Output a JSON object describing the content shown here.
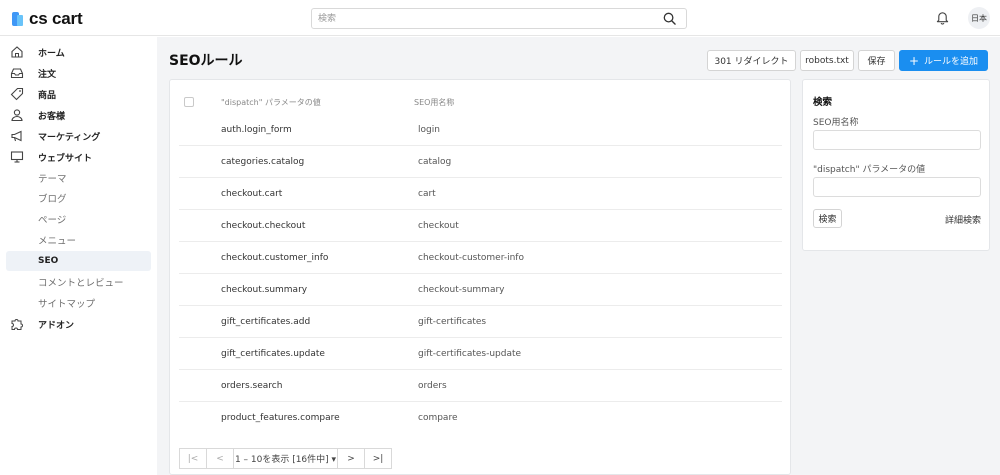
{
  "app": {
    "logo_text": "cs cart",
    "lang": "日本"
  },
  "search": {
    "placeholder": "検索"
  },
  "sidebar": {
    "items": [
      {
        "label": "ホーム",
        "icon": "home-icon"
      },
      {
        "label": "注文",
        "icon": "inbox-icon"
      },
      {
        "label": "商品",
        "icon": "tag-icon"
      },
      {
        "label": "お客様",
        "icon": "user-icon"
      },
      {
        "label": "マーケティング",
        "icon": "megaphone-icon"
      },
      {
        "label": "ウェブサイト",
        "icon": "monitor-icon"
      }
    ],
    "sub_items": [
      "テーマ",
      "ブログ",
      "ページ",
      "メニュー",
      "SEO",
      "コメントとレビュー",
      "サイトマップ"
    ],
    "active_sub": "SEO",
    "addons": {
      "label": "アドオン",
      "icon": "puzzle-icon"
    }
  },
  "page": {
    "title": "SEOルール",
    "buttons": {
      "redirect": "301 リダイレクト",
      "robots": "robots.txt",
      "save": "保存",
      "add_rule": "ルールを追加"
    }
  },
  "table": {
    "headers": {
      "dispatch": "\"dispatch\" パラメータの値",
      "seo_name": "SEO用名称"
    },
    "rows": [
      {
        "dispatch": "auth.login_form",
        "seo_name": "login"
      },
      {
        "dispatch": "categories.catalog",
        "seo_name": "catalog"
      },
      {
        "dispatch": "checkout.cart",
        "seo_name": "cart"
      },
      {
        "dispatch": "checkout.checkout",
        "seo_name": "checkout"
      },
      {
        "dispatch": "checkout.customer_info",
        "seo_name": "checkout-customer-info"
      },
      {
        "dispatch": "checkout.summary",
        "seo_name": "checkout-summary"
      },
      {
        "dispatch": "gift_certificates.add",
        "seo_name": "gift-certificates"
      },
      {
        "dispatch": "gift_certificates.update",
        "seo_name": "gift-certificates-update"
      },
      {
        "dispatch": "orders.search",
        "seo_name": "orders"
      },
      {
        "dispatch": "product_features.compare",
        "seo_name": "compare"
      }
    ]
  },
  "pager": {
    "first": "|<",
    "prev": "<",
    "range": "1 – 10を表示 [16件中] ▾",
    "next": ">",
    "last": ">|"
  },
  "filter": {
    "title": "検索",
    "seo_name_label": "SEO用名称",
    "dispatch_label": "\"dispatch\" パラメータの値",
    "search_button": "検索",
    "advanced": "詳細検索"
  },
  "colors": {
    "accent": "#1a8ef0",
    "logo_dark": "#3f97f6",
    "logo_light": "#69c3f9",
    "active_bg": "#eef2f7"
  }
}
